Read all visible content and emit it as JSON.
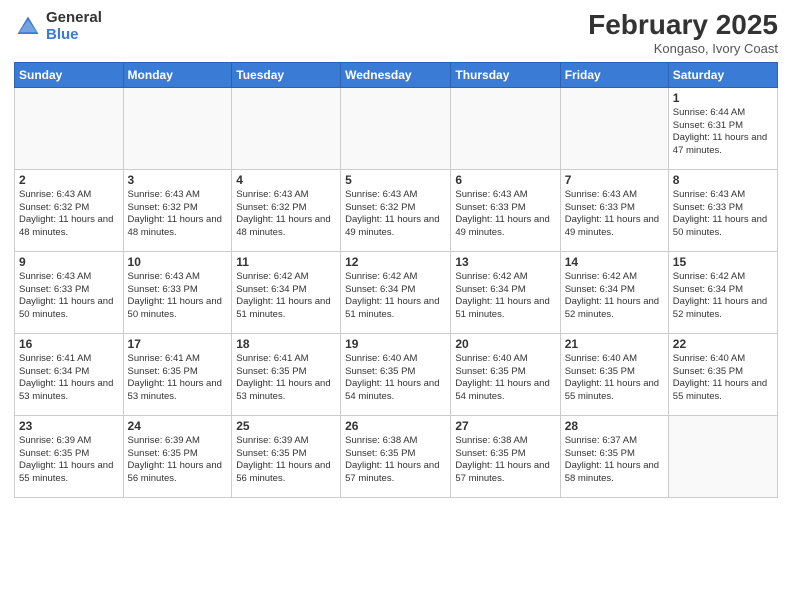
{
  "header": {
    "logo_general": "General",
    "logo_blue": "Blue",
    "month_title": "February 2025",
    "location": "Kongaso, Ivory Coast"
  },
  "days_of_week": [
    "Sunday",
    "Monday",
    "Tuesday",
    "Wednesday",
    "Thursday",
    "Friday",
    "Saturday"
  ],
  "weeks": [
    [
      {
        "day": "",
        "info": ""
      },
      {
        "day": "",
        "info": ""
      },
      {
        "day": "",
        "info": ""
      },
      {
        "day": "",
        "info": ""
      },
      {
        "day": "",
        "info": ""
      },
      {
        "day": "",
        "info": ""
      },
      {
        "day": "1",
        "info": "Sunrise: 6:44 AM\nSunset: 6:31 PM\nDaylight: 11 hours and 47 minutes."
      }
    ],
    [
      {
        "day": "2",
        "info": "Sunrise: 6:43 AM\nSunset: 6:32 PM\nDaylight: 11 hours and 48 minutes."
      },
      {
        "day": "3",
        "info": "Sunrise: 6:43 AM\nSunset: 6:32 PM\nDaylight: 11 hours and 48 minutes."
      },
      {
        "day": "4",
        "info": "Sunrise: 6:43 AM\nSunset: 6:32 PM\nDaylight: 11 hours and 48 minutes."
      },
      {
        "day": "5",
        "info": "Sunrise: 6:43 AM\nSunset: 6:32 PM\nDaylight: 11 hours and 49 minutes."
      },
      {
        "day": "6",
        "info": "Sunrise: 6:43 AM\nSunset: 6:33 PM\nDaylight: 11 hours and 49 minutes."
      },
      {
        "day": "7",
        "info": "Sunrise: 6:43 AM\nSunset: 6:33 PM\nDaylight: 11 hours and 49 minutes."
      },
      {
        "day": "8",
        "info": "Sunrise: 6:43 AM\nSunset: 6:33 PM\nDaylight: 11 hours and 50 minutes."
      }
    ],
    [
      {
        "day": "9",
        "info": "Sunrise: 6:43 AM\nSunset: 6:33 PM\nDaylight: 11 hours and 50 minutes."
      },
      {
        "day": "10",
        "info": "Sunrise: 6:43 AM\nSunset: 6:33 PM\nDaylight: 11 hours and 50 minutes."
      },
      {
        "day": "11",
        "info": "Sunrise: 6:42 AM\nSunset: 6:34 PM\nDaylight: 11 hours and 51 minutes."
      },
      {
        "day": "12",
        "info": "Sunrise: 6:42 AM\nSunset: 6:34 PM\nDaylight: 11 hours and 51 minutes."
      },
      {
        "day": "13",
        "info": "Sunrise: 6:42 AM\nSunset: 6:34 PM\nDaylight: 11 hours and 51 minutes."
      },
      {
        "day": "14",
        "info": "Sunrise: 6:42 AM\nSunset: 6:34 PM\nDaylight: 11 hours and 52 minutes."
      },
      {
        "day": "15",
        "info": "Sunrise: 6:42 AM\nSunset: 6:34 PM\nDaylight: 11 hours and 52 minutes."
      }
    ],
    [
      {
        "day": "16",
        "info": "Sunrise: 6:41 AM\nSunset: 6:34 PM\nDaylight: 11 hours and 53 minutes."
      },
      {
        "day": "17",
        "info": "Sunrise: 6:41 AM\nSunset: 6:35 PM\nDaylight: 11 hours and 53 minutes."
      },
      {
        "day": "18",
        "info": "Sunrise: 6:41 AM\nSunset: 6:35 PM\nDaylight: 11 hours and 53 minutes."
      },
      {
        "day": "19",
        "info": "Sunrise: 6:40 AM\nSunset: 6:35 PM\nDaylight: 11 hours and 54 minutes."
      },
      {
        "day": "20",
        "info": "Sunrise: 6:40 AM\nSunset: 6:35 PM\nDaylight: 11 hours and 54 minutes."
      },
      {
        "day": "21",
        "info": "Sunrise: 6:40 AM\nSunset: 6:35 PM\nDaylight: 11 hours and 55 minutes."
      },
      {
        "day": "22",
        "info": "Sunrise: 6:40 AM\nSunset: 6:35 PM\nDaylight: 11 hours and 55 minutes."
      }
    ],
    [
      {
        "day": "23",
        "info": "Sunrise: 6:39 AM\nSunset: 6:35 PM\nDaylight: 11 hours and 55 minutes."
      },
      {
        "day": "24",
        "info": "Sunrise: 6:39 AM\nSunset: 6:35 PM\nDaylight: 11 hours and 56 minutes."
      },
      {
        "day": "25",
        "info": "Sunrise: 6:39 AM\nSunset: 6:35 PM\nDaylight: 11 hours and 56 minutes."
      },
      {
        "day": "26",
        "info": "Sunrise: 6:38 AM\nSunset: 6:35 PM\nDaylight: 11 hours and 57 minutes."
      },
      {
        "day": "27",
        "info": "Sunrise: 6:38 AM\nSunset: 6:35 PM\nDaylight: 11 hours and 57 minutes."
      },
      {
        "day": "28",
        "info": "Sunrise: 6:37 AM\nSunset: 6:35 PM\nDaylight: 11 hours and 58 minutes."
      },
      {
        "day": "",
        "info": ""
      }
    ]
  ]
}
